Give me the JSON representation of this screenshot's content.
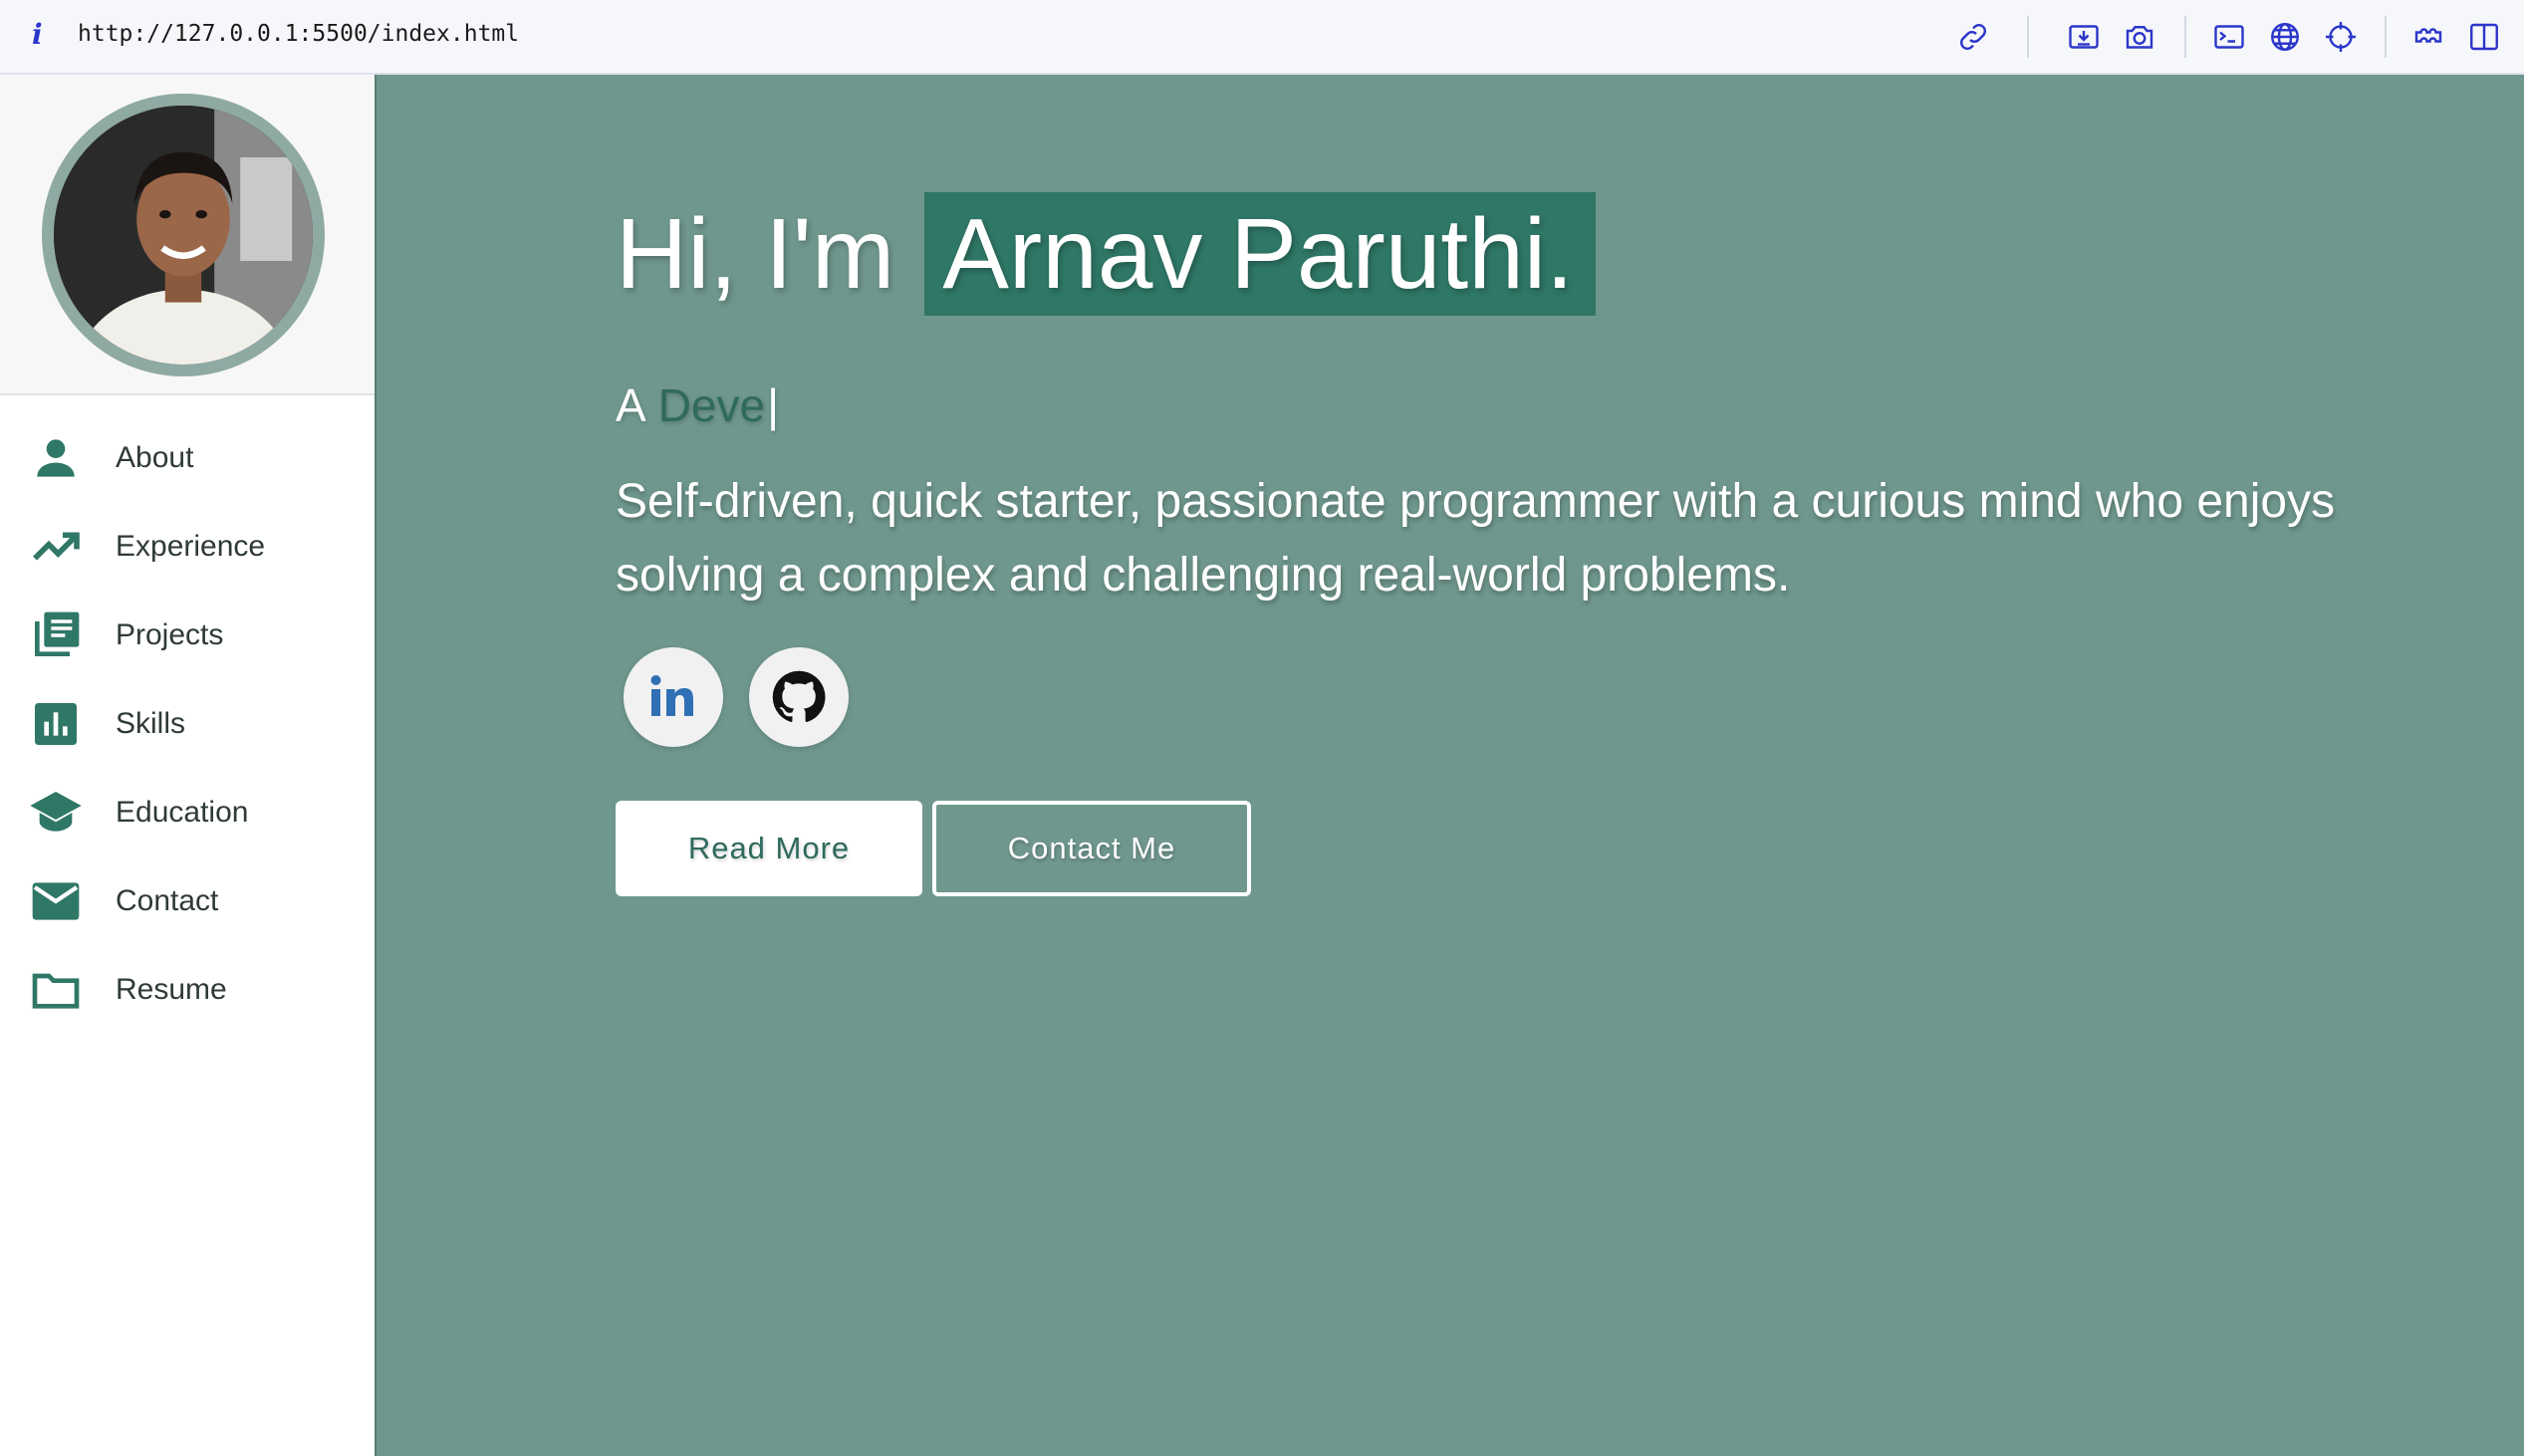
{
  "browser": {
    "info_icon": "info-icon",
    "url": "http://127.0.0.1:5500/index.html",
    "toolbar_icons": [
      "link-icon",
      "screenshot-icon",
      "camera-icon",
      "terminal-icon",
      "globe-icon",
      "crosshair-icon",
      "extensions-icon",
      "split-view-icon"
    ]
  },
  "sidebar": {
    "items": [
      {
        "label": "About",
        "icon": "person-icon"
      },
      {
        "label": "Experience",
        "icon": "trending-up-icon"
      },
      {
        "label": "Projects",
        "icon": "library-books-icon"
      },
      {
        "label": "Skills",
        "icon": "bar-chart-icon"
      },
      {
        "label": "Education",
        "icon": "graduation-cap-icon"
      },
      {
        "label": "Contact",
        "icon": "mail-icon"
      },
      {
        "label": "Resume",
        "icon": "folder-icon"
      }
    ]
  },
  "hero": {
    "greeting": "Hi, I'm",
    "name": "Arnav Paruthi.",
    "typed_prefix": "A",
    "typed_word": "Deve",
    "typed_cursor": "|",
    "tagline": "Self-driven, quick starter, passionate programmer with a curious mind who enjoys solving a complex and challenging real-world problems.",
    "social_links": [
      "linkedin-icon",
      "github-icon"
    ],
    "read_more_label": "Read More",
    "contact_label": "Contact Me"
  },
  "colors": {
    "accent": "#2f7766",
    "main_bg": "#6f978d",
    "sidebar_icon": "#2f7766",
    "avatar_ring": "#8fa9a3"
  }
}
